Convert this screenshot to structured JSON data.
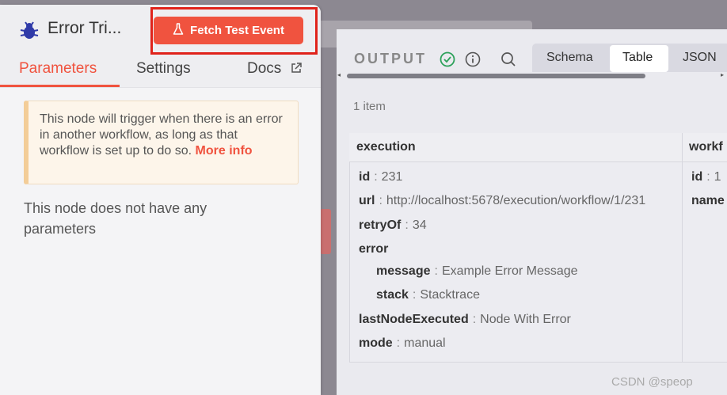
{
  "node": {
    "title": "Error Tri...",
    "fetch_button": "Fetch Test Event",
    "tabs": {
      "parameters": "Parameters",
      "settings": "Settings",
      "docs": "Docs"
    },
    "notice_text": "This node will trigger when there is an error in another workflow, as long as that workflow is set up to do so.",
    "notice_link": "More info",
    "no_params_text": "This node does not have any parameters"
  },
  "output": {
    "label": "OUTPUT",
    "views": {
      "schema": "Schema",
      "table": "Table",
      "json": "JSON"
    },
    "selected_view": "Table",
    "item_count": "1 item",
    "columns": [
      "execution",
      "workf"
    ],
    "execution": {
      "id_key": "id",
      "id_val": "231",
      "url_key": "url",
      "url_val": "http://localhost:5678/execution/workflow/1/231",
      "retry_key": "retryOf",
      "retry_val": "34",
      "error_key": "error",
      "message_key": "message",
      "message_val": "Example Error Message",
      "stack_key": "stack",
      "stack_val": "Stacktrace",
      "last_key": "lastNodeExecuted",
      "last_val": "Node With Error",
      "mode_key": "mode",
      "mode_val": "manual"
    },
    "workflow": {
      "id_key": "id",
      "id_val": "1",
      "name_key": "name"
    }
  },
  "background": {
    "glyph": "r"
  },
  "watermark": "CSDN @speop",
  "colors": {
    "accent": "#f0533f",
    "highlight_box": "#e0231b",
    "success": "#2ca15a"
  }
}
